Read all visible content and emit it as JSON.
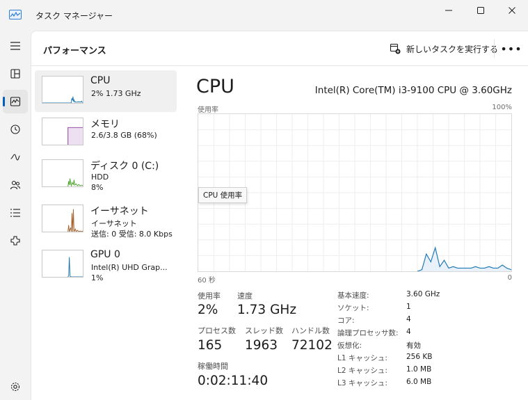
{
  "window": {
    "title": "タスク マネージャー"
  },
  "header": {
    "page_title": "パフォーマンス",
    "run_task_label": "新しいタスクを実行する",
    "more_label": "•••"
  },
  "resources": [
    {
      "name": "CPU",
      "line1": "2%  1.73 GHz"
    },
    {
      "name": "メモリ",
      "line1": "2.6/3.8 GB (68%)"
    },
    {
      "name": "ディスク 0 (C:)",
      "line1": "HDD",
      "line2": "8%"
    },
    {
      "name": "イーサネット",
      "line1": "イーサネット",
      "line2": "送信: 0 受信: 8.0 Kbps"
    },
    {
      "name": "GPU 0",
      "line1": "Intel(R) UHD Grap...",
      "line2": "1%"
    }
  ],
  "main": {
    "title": "CPU",
    "model": "Intel(R) Core(TM) i3-9100 CPU @ 3.60GHz",
    "graph": {
      "y_label": "使用率",
      "y_max_label": "100%",
      "x_left_label": "60 秒",
      "x_right_label": "0",
      "tooltip": "CPU 使用率",
      "usage_percent": [
        0,
        0,
        0,
        0,
        0,
        0,
        0,
        0,
        0,
        0,
        0,
        0,
        0,
        0,
        0,
        0,
        0,
        0,
        0,
        0,
        0,
        0,
        0,
        0,
        0,
        0,
        0,
        0,
        0,
        0,
        0,
        0,
        0,
        0,
        0,
        0,
        0,
        0,
        0,
        0,
        0,
        0,
        0,
        0,
        0,
        0,
        0,
        0,
        0,
        0,
        1,
        11,
        6,
        15,
        3,
        7,
        2,
        3,
        2,
        2,
        2,
        2,
        3,
        2,
        2,
        3,
        2,
        2,
        4,
        2,
        1
      ]
    },
    "stats": {
      "usage_label": "使用率",
      "usage_value": "2%",
      "speed_label": "速度",
      "speed_value": "1.73 GHz",
      "process_label": "プロセス数",
      "process_value": "165",
      "thread_label": "スレッド数",
      "thread_value": "1963",
      "handle_label": "ハンドル数",
      "handle_value": "72102",
      "uptime_label": "稼働時間",
      "uptime_value": "0:02:11:40"
    },
    "details": [
      {
        "key": "基本速度:",
        "value": "3.60 GHz"
      },
      {
        "key": "ソケット:",
        "value": "1"
      },
      {
        "key": "コア:",
        "value": "4"
      },
      {
        "key": "論理プロセッサ数:",
        "value": "4"
      },
      {
        "key": "仮想化:",
        "value": "有効"
      },
      {
        "key": "L1 キャッシュ:",
        "value": "256 KB"
      },
      {
        "key": "L2 キャッシュ:",
        "value": "1.0 MB"
      },
      {
        "key": "L3 キャッシュ:",
        "value": "6.0 MB"
      }
    ]
  },
  "colors": {
    "cpu_line": "#1e78b4",
    "memory_line": "#8b3d9c",
    "disk_line": "#4da32a",
    "net_line": "#a4622c",
    "gpu_line": "#1e78b4",
    "accent": "#005fb8"
  },
  "icons": [
    "app-performance-icon",
    "minimize-icon",
    "maximize-icon",
    "close-icon",
    "hamburger-icon",
    "processes-icon",
    "performance-icon",
    "history-icon",
    "startup-icon",
    "users-icon",
    "details-icon",
    "services-icon",
    "settings-icon",
    "run-task-icon"
  ]
}
